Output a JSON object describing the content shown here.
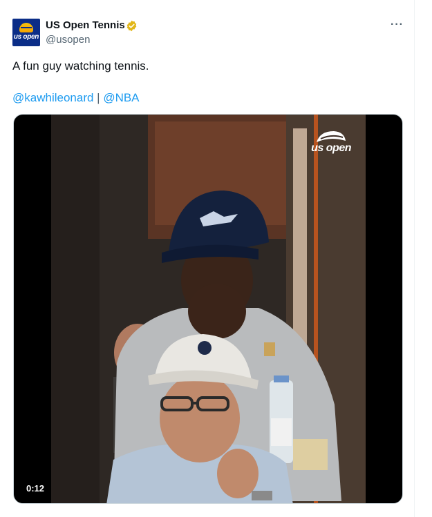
{
  "account": {
    "name": "US Open Tennis",
    "handle": "@usopen",
    "avatar_text": "us open",
    "verified_color": "#e2b719"
  },
  "more_label": "···",
  "tweet": {
    "text": "A fun guy watching tennis.",
    "links": [
      "@kawhileonard",
      "@NBA"
    ],
    "separator": " | "
  },
  "media": {
    "type": "video",
    "watermark": "us open",
    "timestamp": "0:12"
  },
  "colors": {
    "link": "#1d9bf0",
    "secondary": "#536471",
    "brand_navy": "#0b2d87"
  }
}
